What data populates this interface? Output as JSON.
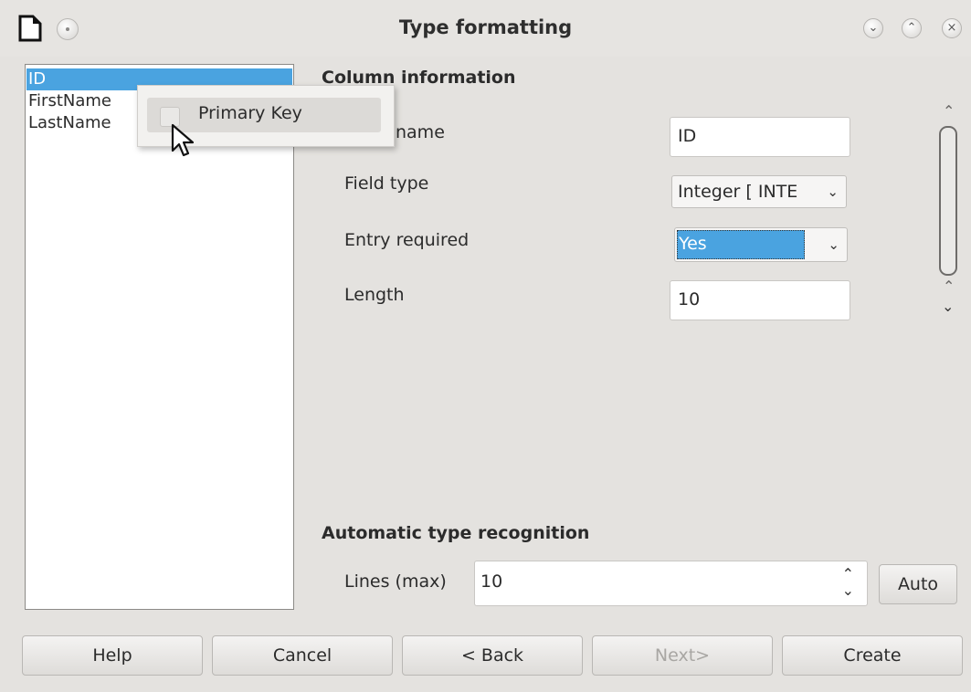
{
  "window": {
    "title": "Type formatting"
  },
  "field_list": {
    "items": [
      "ID",
      "FirstName",
      "LastName"
    ],
    "selected": "ID"
  },
  "context_menu": {
    "item_label": "Primary Key",
    "checked": false
  },
  "column_info": {
    "heading": "Column information",
    "field_name_label": "name",
    "field_name_value": "ID",
    "field_type_label": "Field type",
    "field_type_value": "Integer [ INTE",
    "entry_required_label": "Entry required",
    "entry_required_value": "Yes",
    "length_label": "Length",
    "length_value": "10"
  },
  "auto_recognition": {
    "heading": "Automatic type recognition",
    "lines_label": "Lines (max)",
    "lines_value": "10",
    "auto_button": "Auto"
  },
  "buttons": {
    "help": "Help",
    "cancel": "Cancel",
    "back": "< Back",
    "next": "Next>",
    "create": "Create"
  },
  "colors": {
    "selection": "#4aa3e0",
    "background": "#e4e2df"
  },
  "icons": [
    "document-icon",
    "menu-dot-icon",
    "minimize-icon",
    "maximize-icon",
    "close-icon",
    "mouse-cursor-icon",
    "chevron-down-icon",
    "scroll-up-icon",
    "scroll-down-icon"
  ]
}
